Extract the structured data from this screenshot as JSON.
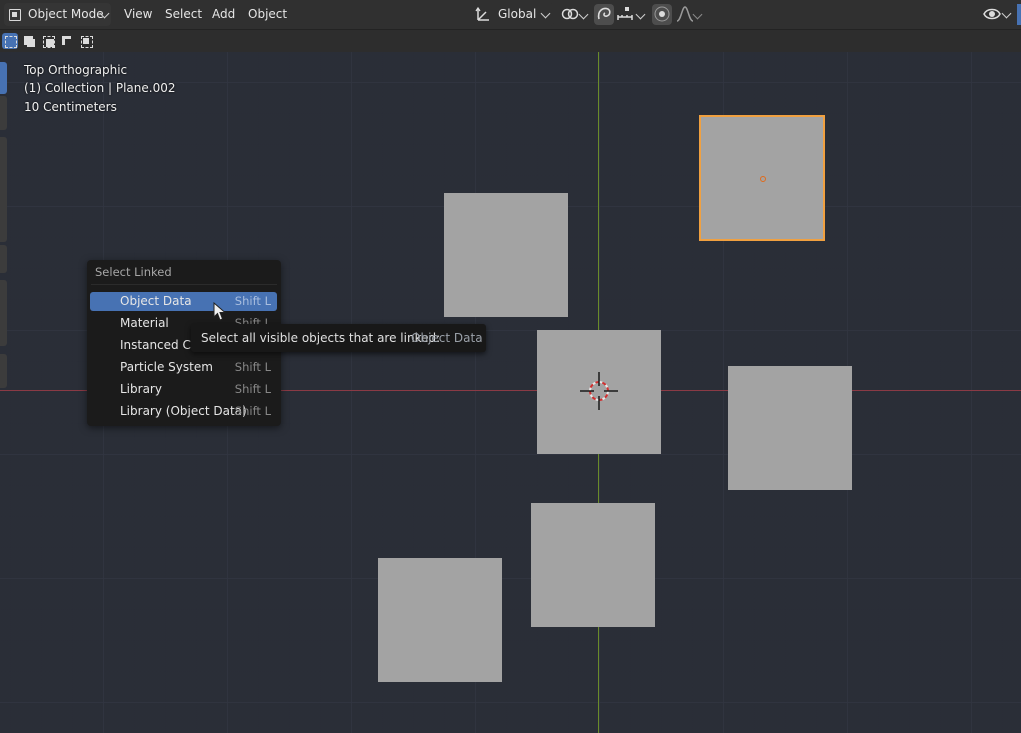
{
  "header": {
    "mode_label": "Object Mode",
    "menu": [
      "View",
      "Select",
      "Add",
      "Object"
    ],
    "transform_orientation": "Global"
  },
  "viewport": {
    "view_name": "Top Orthographic",
    "collection_info": "(1) Collection | Plane.002",
    "scale_info": "10 Centimeters"
  },
  "popup": {
    "title": "Select Linked",
    "items": [
      {
        "label": "Object Data",
        "shortcut": "Shift L",
        "highlighted": true
      },
      {
        "label": "Material",
        "shortcut": "Shift L"
      },
      {
        "label": "Instanced Co",
        "shortcut": ""
      },
      {
        "label": "Particle System",
        "shortcut": "Shift L"
      },
      {
        "label": "Library",
        "shortcut": "Shift L"
      },
      {
        "label": "Library (Object Data)",
        "shortcut": "Shift L"
      }
    ]
  },
  "tooltip": {
    "text": "Select all visible objects that are linked:",
    "value": "Object Data"
  },
  "colors": {
    "accent": "#4772b3",
    "selection_outline": "#f0a040",
    "plane": "#a3a3a3",
    "x_axis": "#8a3a45",
    "y_axis": "#6a8b2a"
  },
  "icons": [
    "object-mode-icon",
    "transform-orientation-icon",
    "pivot-icon",
    "snap-icon",
    "snap-increment-icon",
    "proportional-edit-icon",
    "falloff-icon",
    "visibility-icon"
  ]
}
